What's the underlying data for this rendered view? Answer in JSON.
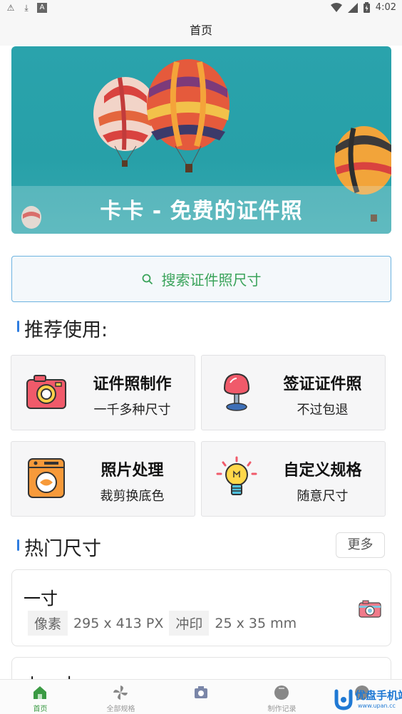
{
  "status_bar": {
    "time": "4:02",
    "left_icons": [
      "warning-icon",
      "download-icon",
      "font-app-icon"
    ],
    "right_icons": [
      "wifi-icon",
      "signal-icon",
      "battery-icon"
    ]
  },
  "title_bar": {
    "title": "首页"
  },
  "banner": {
    "title": "卡卡 - 免费的证件照"
  },
  "search": {
    "placeholder": "搜索证件照尺寸",
    "icon": "search-icon"
  },
  "recommend": {
    "heading": "推荐使用:",
    "items": [
      {
        "title": "证件照制作",
        "subtitle": "一千多种尺寸",
        "icon": "camera-icon"
      },
      {
        "title": "签证证件照",
        "subtitle": "不过包退",
        "icon": "stamp-icon"
      },
      {
        "title": "照片处理",
        "subtitle": "裁剪换底色",
        "icon": "washing-machine-icon"
      },
      {
        "title": "自定义规格",
        "subtitle": "随意尺寸",
        "icon": "light-bulb-icon"
      }
    ]
  },
  "hot_sizes": {
    "heading": "热门尺寸",
    "more_label": "更多",
    "items": [
      {
        "name": "一寸",
        "pixel_label": "像素",
        "pixel_value": "295 x 413 PX",
        "print_label": "冲印",
        "print_value": "25 x 35 mm"
      },
      {
        "name": "小一寸"
      }
    ]
  },
  "tabs": [
    {
      "label": "首页",
      "icon": "home-icon",
      "active": true
    },
    {
      "label": "全部规格",
      "icon": "pinwheel-icon",
      "active": false
    },
    {
      "label": "",
      "icon": "camera-icon",
      "active": false
    },
    {
      "label": "制作记录",
      "icon": "record-icon",
      "active": false
    },
    {
      "label": "",
      "icon": "profile-icon",
      "active": false
    }
  ],
  "watermark": {
    "text": "优盘手机站",
    "sub": "www.upan.cc"
  },
  "colors": {
    "accent_green": "#3a9a43",
    "accent_blue": "#2f7de0",
    "banner_teal": "#2aa3ac"
  }
}
